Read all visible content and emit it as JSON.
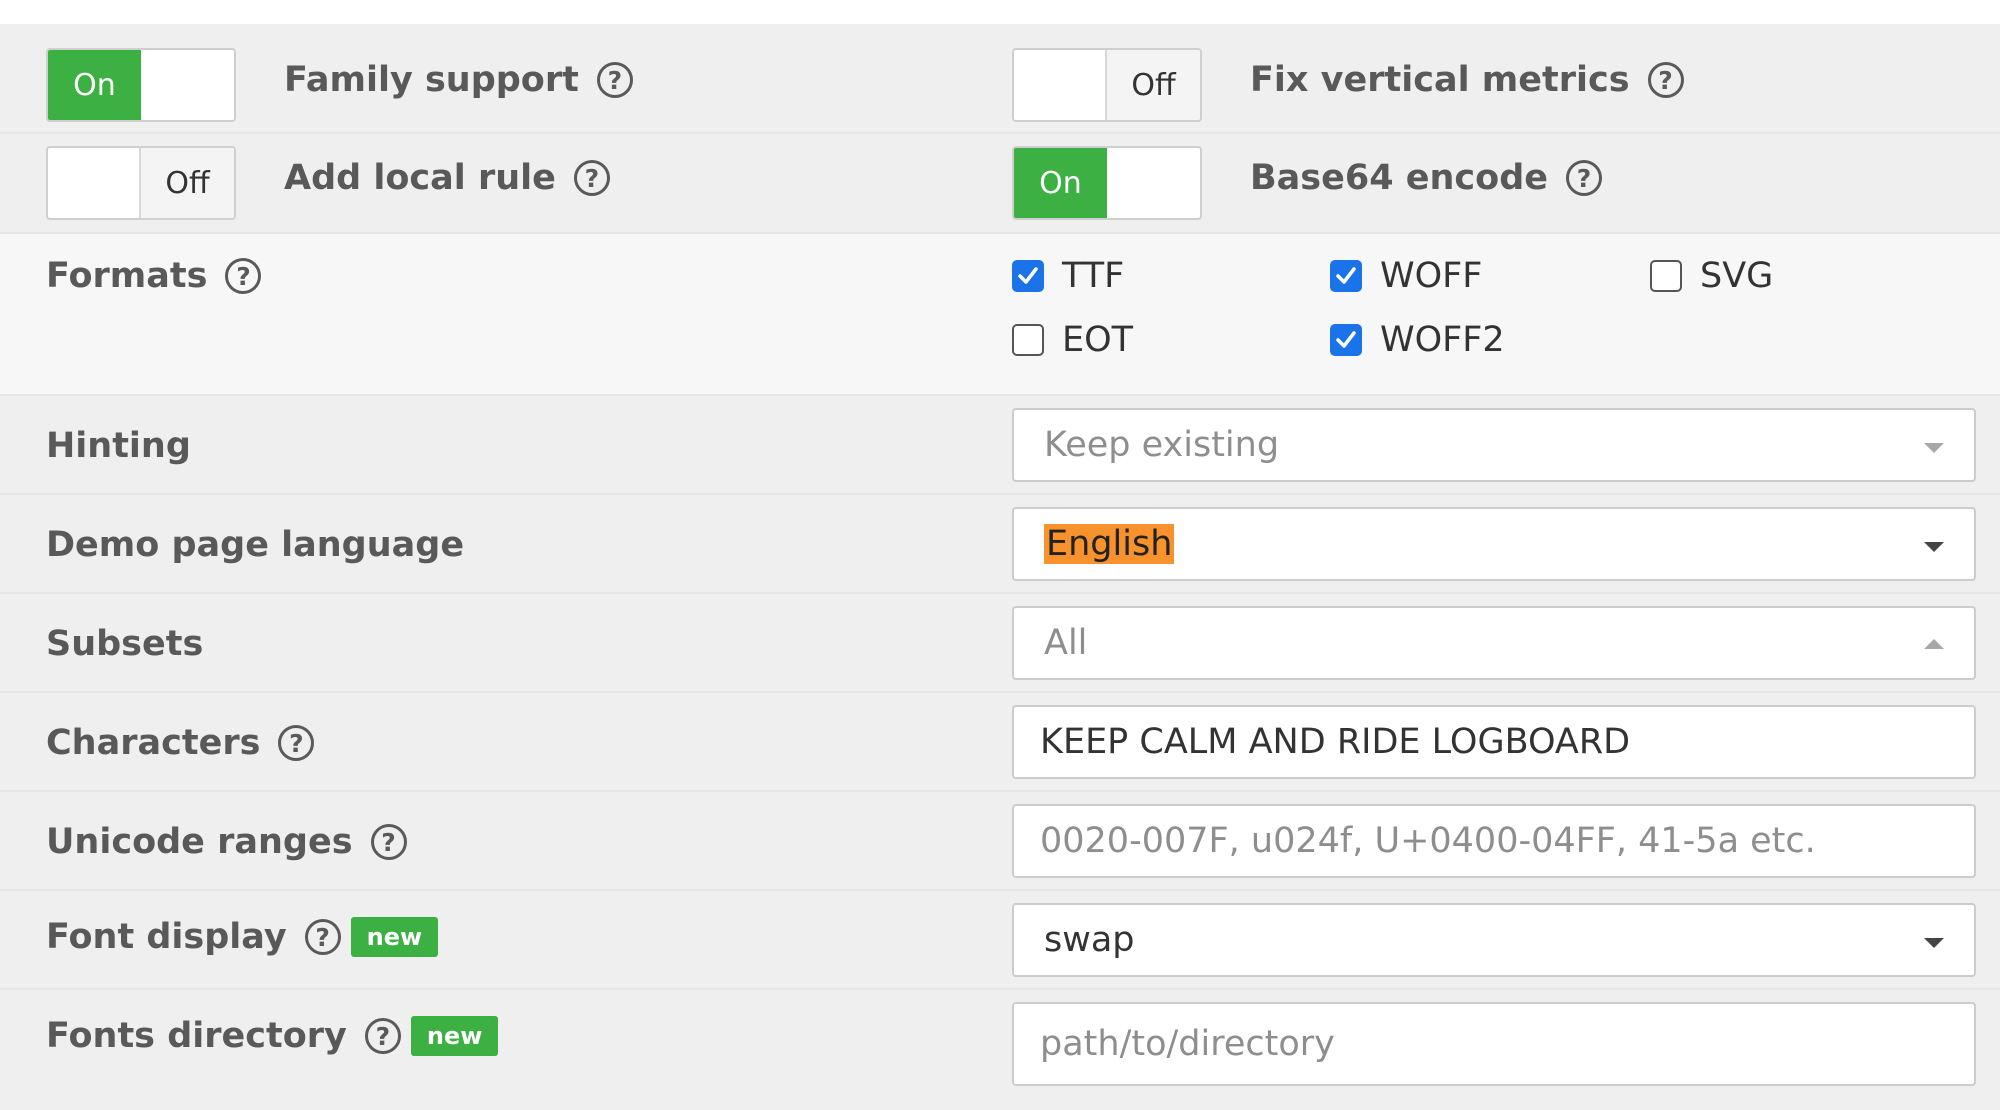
{
  "toggles": {
    "family_support": {
      "label": "Family support",
      "state_label": "On"
    },
    "fix_vertical_metrics": {
      "label": "Fix vertical metrics",
      "state_label": "Off"
    },
    "add_local_rule": {
      "label": "Add local rule",
      "state_label": "Off"
    },
    "base64_encode": {
      "label": "Base64 encode",
      "state_label": "On"
    }
  },
  "help_glyph": "?",
  "formats": {
    "label": "Formats",
    "options": [
      {
        "label": "TTF",
        "checked": true
      },
      {
        "label": "WOFF",
        "checked": true
      },
      {
        "label": "SVG",
        "checked": false
      },
      {
        "label": "EOT",
        "checked": false
      },
      {
        "label": "WOFF2",
        "checked": true
      }
    ]
  },
  "hinting": {
    "label": "Hinting",
    "value": "Keep existing"
  },
  "demo_language": {
    "label": "Demo page language",
    "value": "English"
  },
  "subsets": {
    "label": "Subsets",
    "value": "All"
  },
  "characters": {
    "label": "Characters",
    "value": "KEEP CALM AND RIDE LOGBOARD"
  },
  "unicode_ranges": {
    "label": "Unicode ranges",
    "placeholder": "0020-007F, u024f, U+0400-04FF, 41-5a etc."
  },
  "font_display": {
    "label": "Font display",
    "badge": "new",
    "value": "swap"
  },
  "fonts_directory": {
    "label": "Fonts directory",
    "badge": "new",
    "placeholder": "path/to/directory"
  },
  "colors": {
    "toggle_on": "#3cb043",
    "checkbox": "#1a73e8",
    "highlight": "#f7922c",
    "badge": "#3cb043"
  }
}
